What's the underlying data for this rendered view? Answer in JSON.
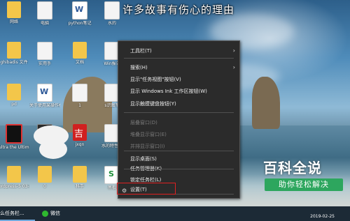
{
  "watermark_text": "许多故事有伤心的理由",
  "desktop_icons": [
    {
      "label": "网络",
      "kind": "folder"
    },
    {
      "label": "电脑",
      "kind": "file"
    },
    {
      "label": "python笔记",
      "kind": "word"
    },
    {
      "label": "水的",
      "kind": "file"
    },
    {
      "label": "ghibadis 文件",
      "kind": "folder"
    },
    {
      "label": "实用手",
      "kind": "file"
    },
    {
      "label": "文档",
      "kind": "folder"
    },
    {
      "label": "Win报告",
      "kind": "file"
    },
    {
      "label": "pd",
      "kind": "folder"
    },
    {
      "label": "关于使用某操作模板",
      "kind": "word"
    },
    {
      "label": "1",
      "kind": "file"
    },
    {
      "label": "s识图笔",
      "kind": "file"
    },
    {
      "label": "ultra the Ultimate",
      "kind": "dark"
    },
    {
      "label": "",
      "kind": "thumb"
    },
    {
      "label": "jxqn",
      "kind": "red"
    },
    {
      "label": "水的特性教",
      "kind": "file"
    },
    {
      "label": "ordpress-5 03-zh_CN",
      "kind": "folder"
    },
    {
      "label": "0",
      "kind": "folder"
    },
    {
      "label": "科手",
      "kind": "folder"
    },
    {
      "label": "黑板",
      "kind": "excel"
    }
  ],
  "context_menu": {
    "items": [
      {
        "label": "工具栏(T)",
        "submenu": true,
        "disabled": false
      },
      {
        "label": "搜索(H)",
        "submenu": true,
        "disabled": false
      },
      {
        "label": "显示\"任务视图\"按钮(V)",
        "submenu": false,
        "disabled": false
      },
      {
        "label": "显示 Windows Ink 工作区按钮(W)",
        "submenu": false,
        "disabled": false
      },
      {
        "label": "显示触摸键盘按钮(Y)",
        "submenu": false,
        "disabled": false
      },
      {
        "label": "层叠窗口(D)",
        "submenu": false,
        "disabled": true
      },
      {
        "label": "堆叠显示窗口(E)",
        "submenu": false,
        "disabled": true
      },
      {
        "label": "并排显示窗口(I)",
        "submenu": false,
        "disabled": true
      },
      {
        "label": "显示桌面(S)",
        "submenu": false,
        "disabled": false
      },
      {
        "label": "任务管理器(K)",
        "submenu": false,
        "disabled": false
      },
      {
        "label": "锁定任务栏(L)",
        "submenu": false,
        "disabled": false
      },
      {
        "label": "设置(T)",
        "submenu": false,
        "disabled": false
      }
    ]
  },
  "taskbar": {
    "apps": [
      {
        "label": "么任务栏..."
      },
      {
        "label": "微信"
      }
    ],
    "date": "2019-02-25"
  },
  "brand": {
    "title": "百科全说",
    "subtitle": "助你轻松解决",
    "accent": "#2da65e"
  }
}
